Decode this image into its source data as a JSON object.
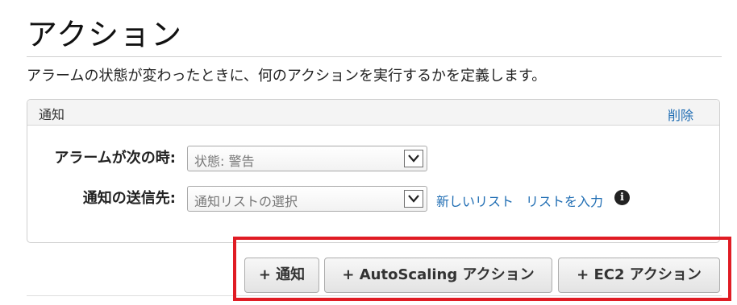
{
  "page": {
    "title": "アクション",
    "description": "アラームの状態が変わったときに、何のアクションを実行するかを定義します。"
  },
  "notification_panel": {
    "title": "通知",
    "delete_link": "削除",
    "state_label": "アラームが次の時:",
    "state_select_value": "状態: 警告",
    "send_to_label": "通知の送信先:",
    "send_to_select_value": "通知リストの選択",
    "new_list_link": "新しいリスト",
    "enter_list_link": "リストを入力",
    "info_icon": "info-icon"
  },
  "actions": {
    "add_notification": "+ 通知",
    "add_autoscaling": "+ AutoScaling アクション",
    "add_ec2": "+ EC2 アクション"
  },
  "colors": {
    "link": "#1f6db3",
    "highlight": "#e01c24"
  }
}
